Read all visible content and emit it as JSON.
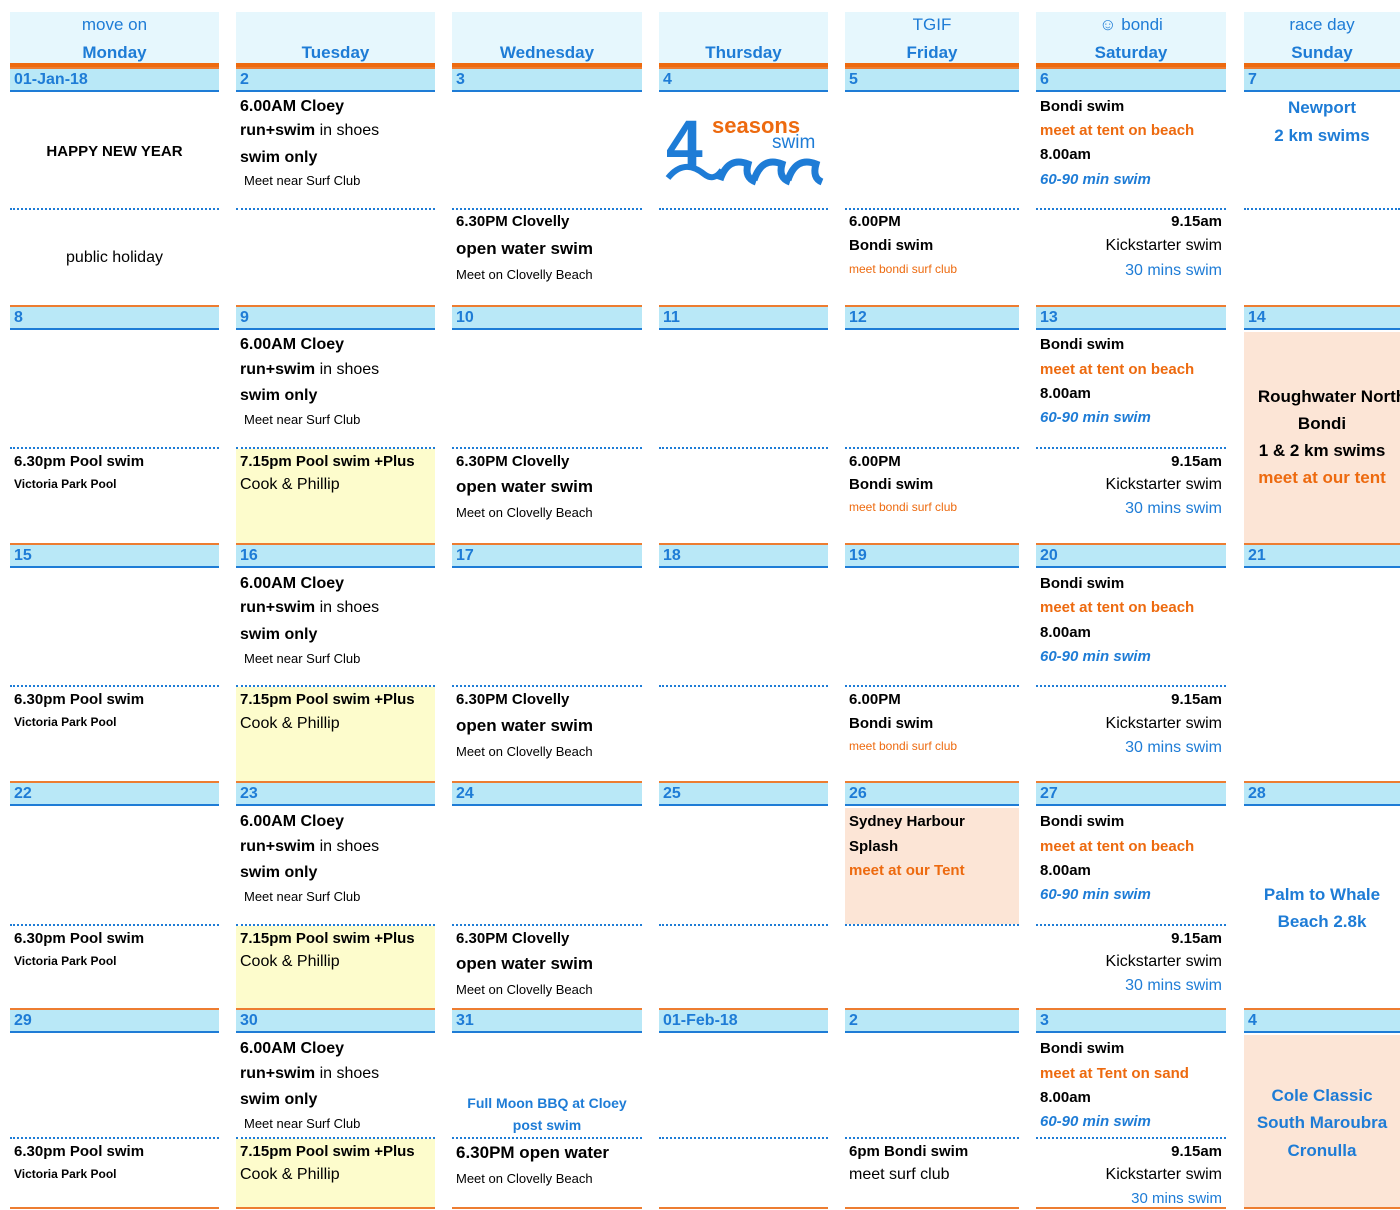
{
  "header": {
    "mon": {
      "tag": "move on",
      "day": "Monday"
    },
    "tue": {
      "tag": "",
      "day": "Tuesday"
    },
    "wed": {
      "tag": "",
      "day": "Wednesday"
    },
    "thu": {
      "tag": "",
      "day": "Thursday"
    },
    "fri": {
      "tag": "TGIF",
      "day": "Friday"
    },
    "sat": {
      "tag": "☺ bondi",
      "day": "Saturday"
    },
    "sun": {
      "tag": "race day",
      "day": "Sunday"
    }
  },
  "dates": {
    "mon": [
      "01-Jan-18",
      "8",
      "15",
      "22",
      "29"
    ],
    "tue": [
      "2",
      "9",
      "16",
      "23",
      "30"
    ],
    "wed": [
      "3",
      "10",
      "17",
      "24",
      "31"
    ],
    "thu": [
      "4",
      "11",
      "18",
      "25",
      "01-Feb-18"
    ],
    "fri": [
      "5",
      "12",
      "19",
      "26",
      "2"
    ],
    "sat": [
      "6",
      "13",
      "20",
      "27",
      "3"
    ],
    "sun": [
      "7",
      "14",
      "21",
      "28",
      "4"
    ]
  },
  "text": {
    "happy_new_year": "HAPPY NEW YEAR",
    "public_holiday": "public holiday",
    "pool_swim": "6.30pm Pool swim",
    "victoria_park": "Victoria Park Pool",
    "cloey_time": "6.00AM Cloey",
    "run_swim": "run+swim",
    "in_shoes": " in shoes",
    "swim_only": "swim only",
    "meet_surf_club": "Meet near Surf Club",
    "pool_plus": "7.15pm Pool swim +Plus",
    "cook_phillip": "Cook & Phillip",
    "clovelly_time": "6.30PM Clovelly",
    "open_water": "open water swim",
    "meet_clovelly": "Meet on Clovelly Beach",
    "full_moon_1": "Full Moon BBQ at Cloey",
    "full_moon_2": "post swim",
    "open_water_630": "6.30PM open water",
    "fri_time": "6.00PM",
    "bondi_swim": "Bondi swim",
    "meet_bondi_sc": "meet bondi surf club",
    "sydney_harbour_1": "Sydney Harbour",
    "sydney_harbour_2": "Splash",
    "meet_our_tent_cap": "meet at our Tent",
    "six_pm_bondi": "6pm Bondi swim",
    "meet_surf_club_lc": "meet surf club",
    "meet_tent_beach": "meet at tent on beach",
    "meet_tent_sand": "meet at Tent on sand",
    "eight_am": "8.00am",
    "min_swim": "60-90 min swim",
    "nine_fifteen": "9.15am",
    "kickstarter": "Kickstarter swim",
    "thirty_mins": "30 mins swim",
    "newport": "Newport",
    "two_km": "2 km swims",
    "roughwater_1": "Roughwater North",
    "roughwater_2": "Bondi",
    "roughwater_3": "1 & 2 km swims",
    "meet_our_tent": "meet at our tent",
    "palm_1": "Palm to Whale",
    "palm_2": "Beach 2.8k",
    "cole_1": "Cole Classic",
    "cole_2": "South Maroubra",
    "cole_3": "Cronulla"
  },
  "logo": {
    "number": "4",
    "line1": "seasons",
    "line2": "swim"
  },
  "colors": {
    "accent_blue": "#1e7cd6",
    "accent_orange": "#ed6a0f",
    "date_bar": "#b9e8f7",
    "header_bg": "#e6f7fd",
    "yellow_fill": "#fdfccc",
    "peach_fill": "#fce5d6"
  }
}
